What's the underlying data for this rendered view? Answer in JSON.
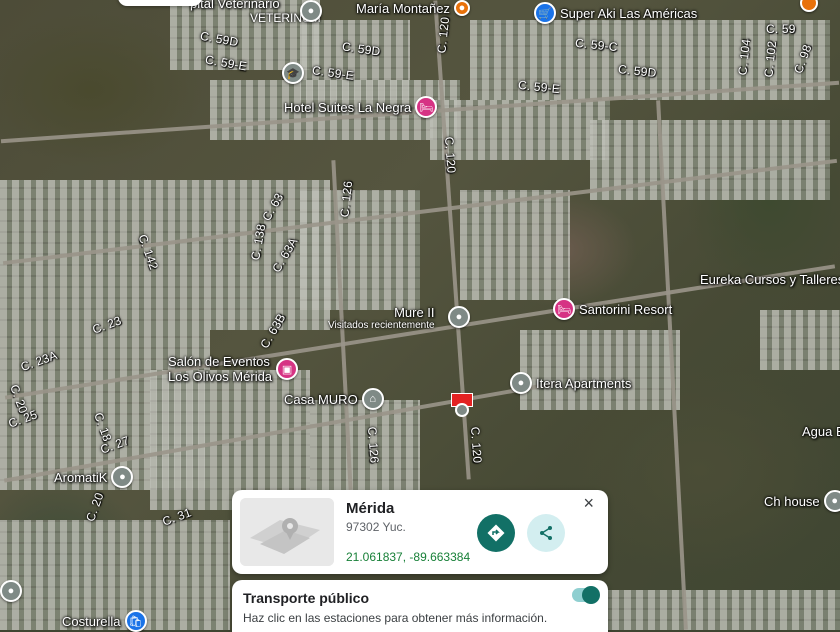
{
  "map": {
    "roads": [
      "C. 59D",
      "C. 59D",
      "C. 59-E",
      "C. 59-E",
      "C. 59-E",
      "C. 59-C",
      "C. 59D",
      "C. 120",
      "C. 120",
      "C. 120",
      "C. 104",
      "C. 102",
      "C. 98",
      "C. 59",
      "C. 63",
      "C. 126",
      "C. 126",
      "C. 138",
      "C. 63A",
      "C. 63B",
      "C. 142",
      "C. 23",
      "C. 23A",
      "C. 20",
      "C. 25",
      "C. 18",
      "C. 27",
      "C. 20",
      "C. 31"
    ],
    "pois": {
      "veterinum": {
        "name": "pital Veterinario",
        "sub": "VETERINUM"
      },
      "maria": {
        "name": "María Montañez"
      },
      "superaki": {
        "name": "Super Aki Las Américas"
      },
      "hotel": {
        "name": "Hotel Suites La Negra"
      },
      "eureka": {
        "name": "Eureka Cursos y Talleres"
      },
      "mure": {
        "name": "Mure II",
        "sub": "Visitados recientemente"
      },
      "santorini": {
        "name": "Santorini Resort"
      },
      "salon": {
        "name": "Salón de Eventos",
        "sub": "Los Olivos Mérida"
      },
      "itera": {
        "name": "Itera Apartments"
      },
      "casa": {
        "name": "Casa MURO"
      },
      "agua": {
        "name": "Agua B"
      },
      "aromatik": {
        "name": "AromatiK"
      },
      "chhouse": {
        "name": "Ch house"
      },
      "costurella": {
        "name": "Costurella"
      }
    }
  },
  "info_card": {
    "title": "Mérida",
    "postal": "97302 Yuc.",
    "coords": "21.061837, -89.663384",
    "close_label": "×"
  },
  "transit": {
    "title": "Transporte público",
    "description": "Haz clic en las estaciones para obtener más información.",
    "enabled": true
  },
  "colors": {
    "accent": "#127066",
    "coords": "#188038",
    "marker": "#e32222",
    "hotel_pin": "#d63384",
    "place_pin": "#7f8a86",
    "shop_pin": "#1a73e8"
  }
}
